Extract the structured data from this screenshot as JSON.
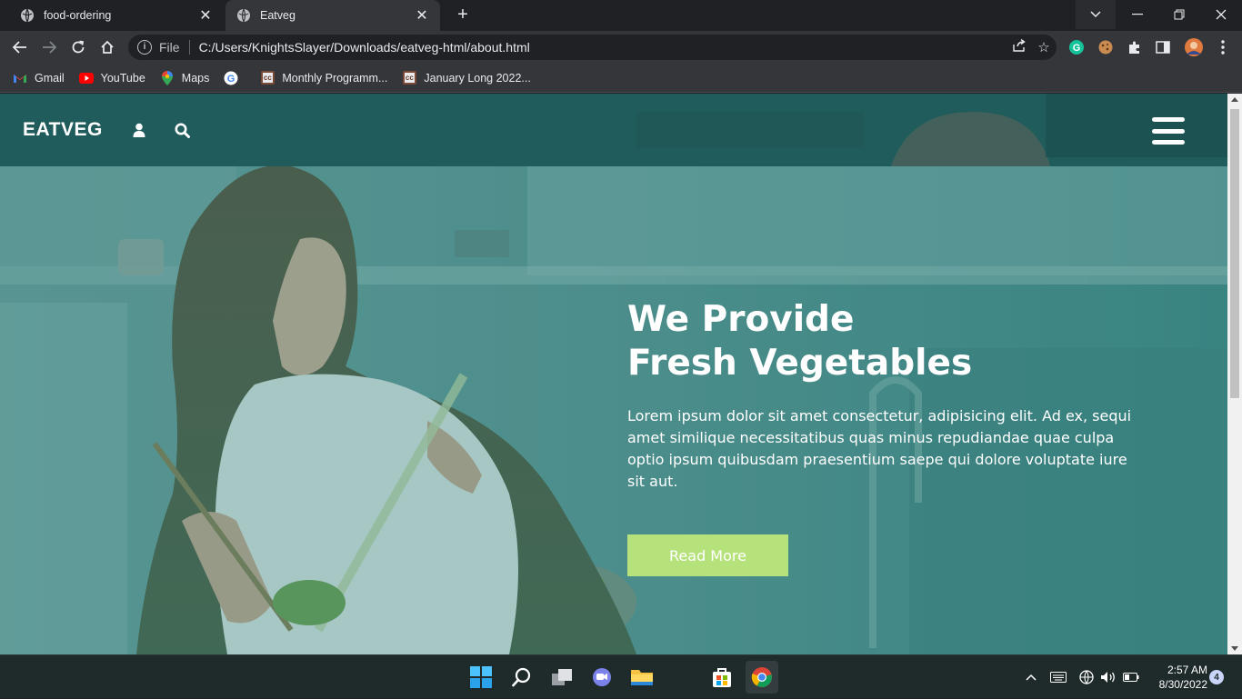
{
  "browser": {
    "tabs": [
      {
        "title": "food-ordering",
        "active": false
      },
      {
        "title": "Eatveg",
        "active": true
      }
    ],
    "omnibox": {
      "scheme_label": "File",
      "url": "C:/Users/KnightsSlayer/Downloads/eatveg-html/about.html"
    },
    "bookmarks": [
      {
        "label": "Gmail",
        "icon": "gmail-icon"
      },
      {
        "label": "YouTube",
        "icon": "youtube-icon"
      },
      {
        "label": "Maps",
        "icon": "maps-icon"
      },
      {
        "label": "",
        "icon": "google-icon"
      },
      {
        "label": "Monthly Programm...",
        "icon": "codechef-icon"
      },
      {
        "label": "January Long 2022...",
        "icon": "codechef-icon"
      }
    ]
  },
  "site": {
    "logo": "EATVEG",
    "hero": {
      "title_line1": "We Provide",
      "title_line2": "Fresh Vegetables",
      "paragraph": "Lorem ipsum dolor sit amet consectetur, adipisicing elit. Ad ex, sequi amet similique necessitatibus quas minus repudiandae quae culpa optio ipsum quibusdam praesentium saepe qui dolore voluptate iure sit aut.",
      "button": "Read More"
    },
    "colors": {
      "button": "#b5e27a",
      "overlay": "#2f7a78"
    }
  },
  "taskbar": {
    "time": "2:57 AM",
    "date": "8/30/2022",
    "notifications": "4"
  }
}
